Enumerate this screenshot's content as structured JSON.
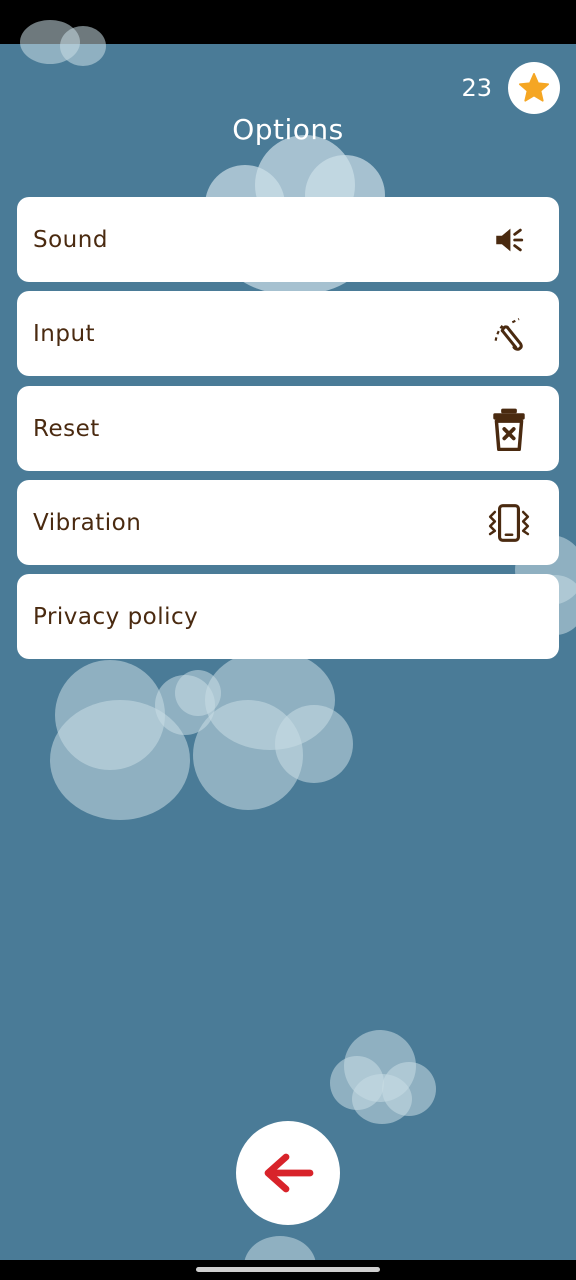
{
  "header": {
    "score": "23",
    "star_icon": "star-icon",
    "title": "Options"
  },
  "options": [
    {
      "label": "Sound",
      "icon": "speaker-icon"
    },
    {
      "label": "Input",
      "icon": "tap-icon"
    },
    {
      "label": "Reset",
      "icon": "trash-icon"
    },
    {
      "label": "Vibration",
      "icon": "vibrate-icon"
    },
    {
      "label": "Privacy policy",
      "icon": ""
    }
  ],
  "footer": {
    "back_icon": "arrow-left-icon"
  },
  "colors": {
    "background": "#4a7b97",
    "card": "#ffffff",
    "text": "#4a2a10",
    "star": "#f5a623",
    "back_arrow": "#d8232a"
  }
}
